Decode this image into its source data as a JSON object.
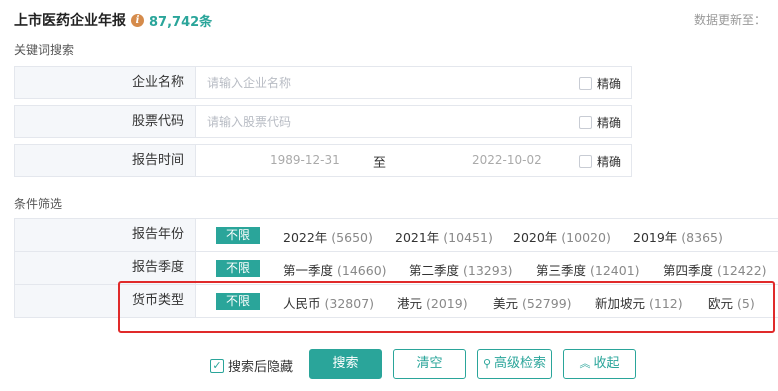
{
  "header": {
    "title": "上市医药企业年报",
    "record_count": "87,742条",
    "update_text": "数据更新至："
  },
  "keyword_section": {
    "label": "关键词搜索",
    "exact_label": "精确",
    "fields": [
      {
        "label": "企业名称",
        "placeholder": "请输入企业名称"
      },
      {
        "label": "股票代码",
        "placeholder": "请输入股票代码"
      }
    ],
    "report_time": {
      "label": "报告时间",
      "start": "1989-12-31",
      "separator": "至",
      "end": "2022-10-02"
    }
  },
  "filter_section": {
    "label": "条件筛选",
    "unlimited_label": "不限",
    "rows": [
      {
        "label": "报告年份",
        "options": [
          {
            "text": "2022年",
            "count": "(5650)"
          },
          {
            "text": "2021年",
            "count": "(10451)"
          },
          {
            "text": "2020年",
            "count": "(10020)"
          },
          {
            "text": "2019年",
            "count": "(8365)"
          }
        ]
      },
      {
        "label": "报告季度",
        "options": [
          {
            "text": "第一季度",
            "count": "(14660)"
          },
          {
            "text": "第二季度",
            "count": "(13293)"
          },
          {
            "text": "第三季度",
            "count": "(12401)"
          },
          {
            "text": "第四季度",
            "count": "(12422)"
          }
        ]
      },
      {
        "label": "货币类型",
        "options": [
          {
            "text": "人民币",
            "count": "(32807)"
          },
          {
            "text": "港元",
            "count": "(2019)"
          },
          {
            "text": "美元",
            "count": "(52799)"
          },
          {
            "text": "新加坡元",
            "count": "(112)"
          },
          {
            "text": "欧元",
            "count": "(5)"
          }
        ]
      }
    ]
  },
  "actions": {
    "hide_after_search": "搜索后隐藏",
    "search": "搜索",
    "clear": "清空",
    "advanced": "高级检索",
    "collapse": "收起"
  },
  "colors": {
    "accent": "#2aa59a",
    "highlight": "#e02a2a",
    "info_icon": "#d58b4b"
  }
}
